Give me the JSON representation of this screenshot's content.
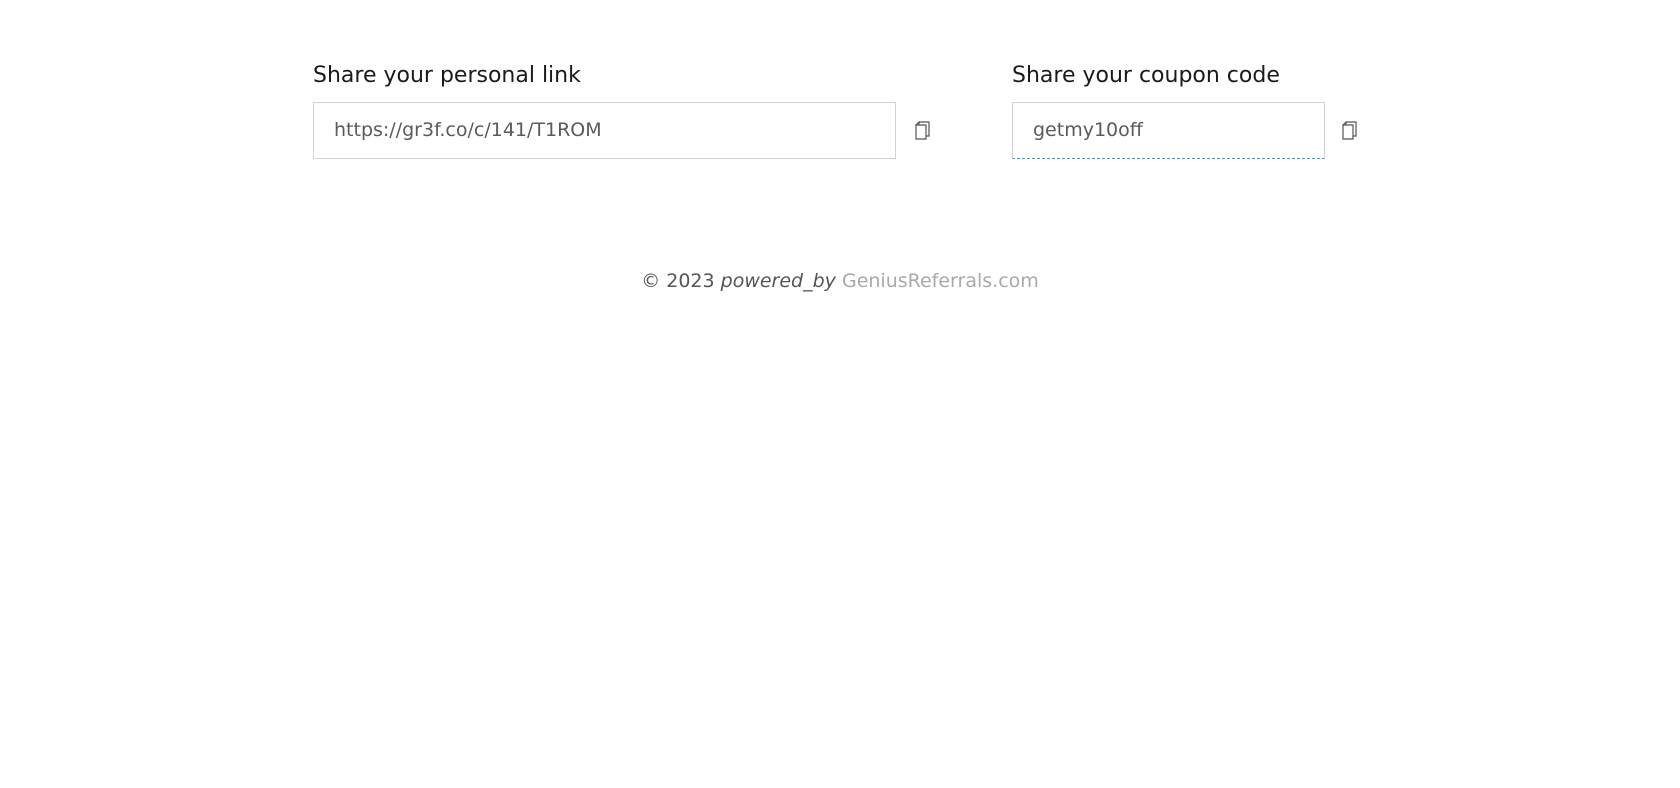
{
  "share_link": {
    "label": "Share your personal link",
    "value": "https://gr3f.co/c/141/T1ROM",
    "copy_icon": "copy-icon"
  },
  "share_coupon": {
    "label": "Share your coupon code",
    "value": "getmy10off",
    "copy_icon": "copy-icon"
  },
  "footer": {
    "copyright": "© 2023",
    "powered_by": "powered_by",
    "brand": "GeniusReferrals.com"
  },
  "colors": {
    "coupon_focus_border": "#2aa6df",
    "field_border": "#d3d3d3",
    "brand_link": "#a9a9a9"
  }
}
